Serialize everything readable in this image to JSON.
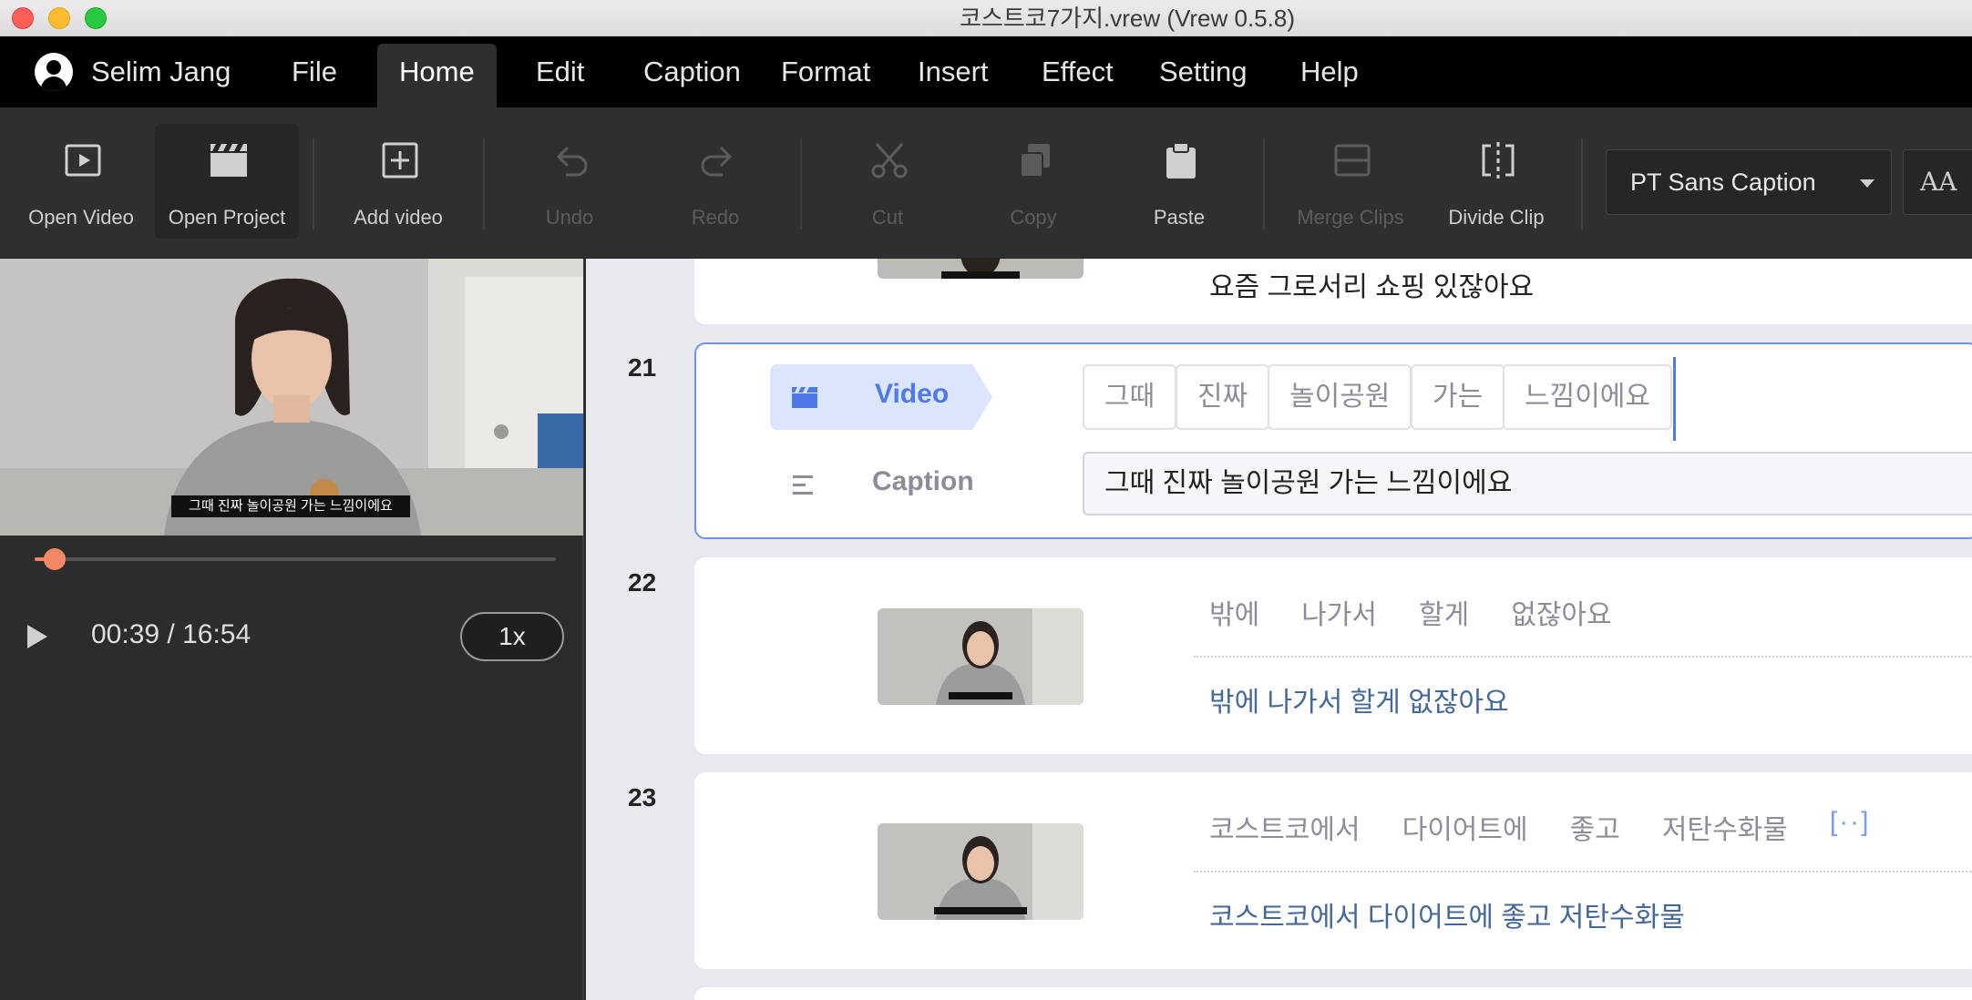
{
  "window": {
    "title": "코스트코7가지.vrew (Vrew 0.5.8)"
  },
  "menubar": {
    "user_name": "Selim Jang",
    "items": [
      "File",
      "Home",
      "Edit",
      "Caption",
      "Format",
      "Insert",
      "Effect",
      "Setting",
      "Help"
    ],
    "active": "Home"
  },
  "toolbar": {
    "tools": [
      {
        "label": "Open Video",
        "icon": "play-square-icon",
        "enabled": true
      },
      {
        "label": "Open Project",
        "icon": "clapperboard-icon",
        "enabled": true,
        "active": true
      },
      {
        "label": "Add video",
        "icon": "plus-square-icon",
        "enabled": true
      },
      {
        "label": "Undo",
        "icon": "undo-icon",
        "enabled": false
      },
      {
        "label": "Redo",
        "icon": "redo-icon",
        "enabled": false
      },
      {
        "label": "Cut",
        "icon": "scissors-icon",
        "enabled": false
      },
      {
        "label": "Copy",
        "icon": "copy-icon",
        "enabled": false
      },
      {
        "label": "Paste",
        "icon": "clipboard-icon",
        "enabled": true
      },
      {
        "label": "Merge Clips",
        "icon": "merge-clips-icon",
        "enabled": false
      },
      {
        "label": "Divide Clip",
        "icon": "divide-clip-icon",
        "enabled": true
      }
    ],
    "font_name": "PT Sans Caption",
    "text_style_icon": "font-size-icon",
    "text_style_glyph": "AA"
  },
  "player": {
    "subtitle": "그때 진짜 놀이공원 가는 느낌이에요",
    "time": "00:39 / 16:54",
    "speed": "1x",
    "progress": 0.039
  },
  "clips": {
    "prev": {
      "caption": "요즘 그로서리 쇼핑 있잖아요"
    },
    "c21": {
      "number": "21",
      "video_label": "Video",
      "caption_label": "Caption",
      "words": [
        "그때",
        "진짜",
        "놀이공원",
        "가는",
        "느낌이에요"
      ],
      "caption": "그때 진짜 놀이공원 가는 느낌이에요"
    },
    "c22": {
      "number": "22",
      "words": [
        "밖에",
        "나가서",
        "할게",
        "없잖아요"
      ],
      "caption": "밖에 나가서 할게 없잖아요"
    },
    "c23": {
      "number": "23",
      "words": [
        "코스트코에서",
        "다이어트에",
        "좋고",
        "저탄수화물"
      ],
      "more": "[··]",
      "caption": "코스트코에서 다이어트에 좋고 저탄수화물"
    }
  },
  "colors": {
    "accent": "#4f79e6",
    "scrub": "#f28766",
    "caption_text": "#44689a"
  }
}
